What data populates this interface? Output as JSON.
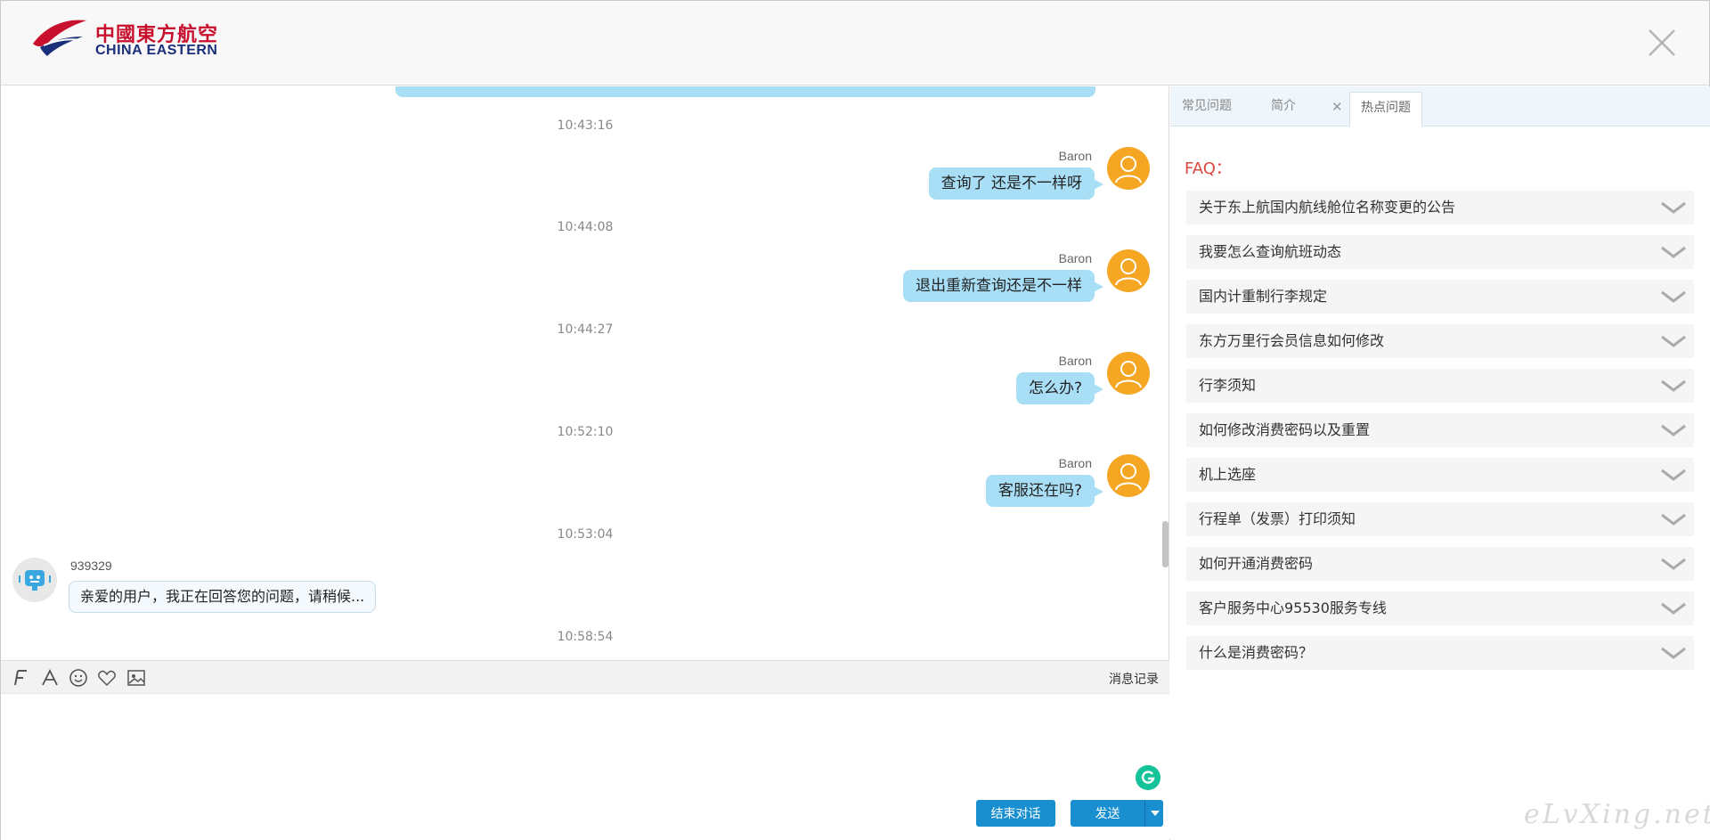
{
  "header": {
    "logo_cn": "中國東方航空",
    "logo_en": "CHINA EASTERN"
  },
  "colors": {
    "brand_red": "#c8102e",
    "brand_blue": "#1a2e7a",
    "bubble_out": "#a8def6",
    "button_blue": "#1a8fd0",
    "faq_title": "#e0483e"
  },
  "chat": {
    "messages": [
      {
        "time": "10:43:16",
        "sender": "Baron",
        "text": "查询了 还是不一样呀"
      },
      {
        "time": "10:44:08",
        "sender": "Baron",
        "text": "退出重新查询还是不一样"
      },
      {
        "time": "10:44:27",
        "sender": "Baron",
        "text": "怎么办?"
      },
      {
        "time": "10:52:10",
        "sender": "Baron",
        "text": "客服还在吗?"
      }
    ],
    "agent": {
      "time": "10:53:04",
      "name": "939329",
      "text": "亲爱的用户，我正在回答您的问题，请稍候..."
    },
    "last_time": "10:58:54"
  },
  "toolbar": {
    "history_label": "消息记录",
    "icons": [
      "font-icon",
      "text-color-icon",
      "emoji-icon",
      "heart-icon",
      "image-icon"
    ]
  },
  "input": {
    "value": "",
    "placeholder": ""
  },
  "buttons": {
    "end_label": "结束对话",
    "send_label": "发送"
  },
  "panel": {
    "tabs": [
      {
        "label": "常见问题"
      },
      {
        "label": "简介"
      },
      {
        "label": "热点问题",
        "active": true
      }
    ],
    "faq_title": "FAQ：",
    "faq_items": [
      "关于东上航国内航线舱位名称变更的公告",
      "我要怎么查询航班动态",
      "国内计重制行李规定",
      "东方万里行会员信息如何修改",
      "行李须知",
      "如何修改消费密码以及重置",
      "机上选座",
      "行程单（发票）打印须知",
      "如何开通消费密码",
      "客户服务中心95530服务专线",
      "什么是消费密码？"
    ]
  },
  "watermark": "eLvXing.net"
}
